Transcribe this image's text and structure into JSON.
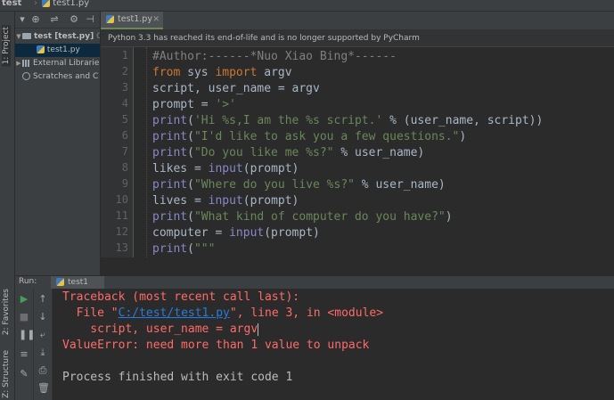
{
  "breadcrumb": {
    "project": "test",
    "file": "test1.py"
  },
  "side_tabs": {
    "project": "1: Project",
    "favorites": "2: Favorites",
    "structure": "Z: Structure"
  },
  "project_tree": [
    {
      "label": "test [test.py]",
      "extra": "C",
      "level": 0,
      "kind": "folder"
    },
    {
      "label": "test1.py",
      "level": 1,
      "kind": "file",
      "selected": true
    },
    {
      "label": "External Librarie",
      "level": 0,
      "kind": "library"
    },
    {
      "label": "Scratches and C",
      "level": 0,
      "kind": "scratch"
    }
  ],
  "editor": {
    "tab_label": "test1.py",
    "banner": "Python 3.3 has reached its end-of-life and is no longer supported by PyCharm",
    "line_numbers": [
      "1",
      "2",
      "3",
      "4",
      "5",
      "6",
      "7",
      "8",
      "9",
      "10",
      "11",
      "12",
      "13"
    ],
    "code": [
      "#Author:------*Nuo Xiao Bing*------",
      "from sys import argv",
      "script, user_name = argv",
      "prompt = '>'",
      "print('Hi %s,I am the %s script.' % (user_name, script))",
      "print(\"I'd like to ask you a few questions.\")",
      "print(\"Do you like me %s?\" % user_name)",
      "likes = input(prompt)",
      "print(\"Where do you live %s?\" % user_name)",
      "lives = input(prompt)",
      "print(\"What kind of computer do you have?\")",
      "computer = input(prompt)",
      "print(\"\"\""
    ]
  },
  "run": {
    "label": "Run:",
    "tab_label": "test1",
    "console": {
      "line1": "Traceback (most recent call last):",
      "line2_pre": "  File \"",
      "line2_link": "C:/test/test1.py",
      "line2_post": "\", line 3, in <module>",
      "line3": "    script, user_name = argv",
      "line4": "ValueError: need more than 1 value to unpack",
      "line5": "Process finished with exit code 1"
    }
  },
  "colors": {
    "keyword": "#cc7832",
    "string": "#6a8759",
    "builtin": "#8888c6",
    "comment": "#808080",
    "error": "#ff6b68",
    "link": "#287bde"
  }
}
